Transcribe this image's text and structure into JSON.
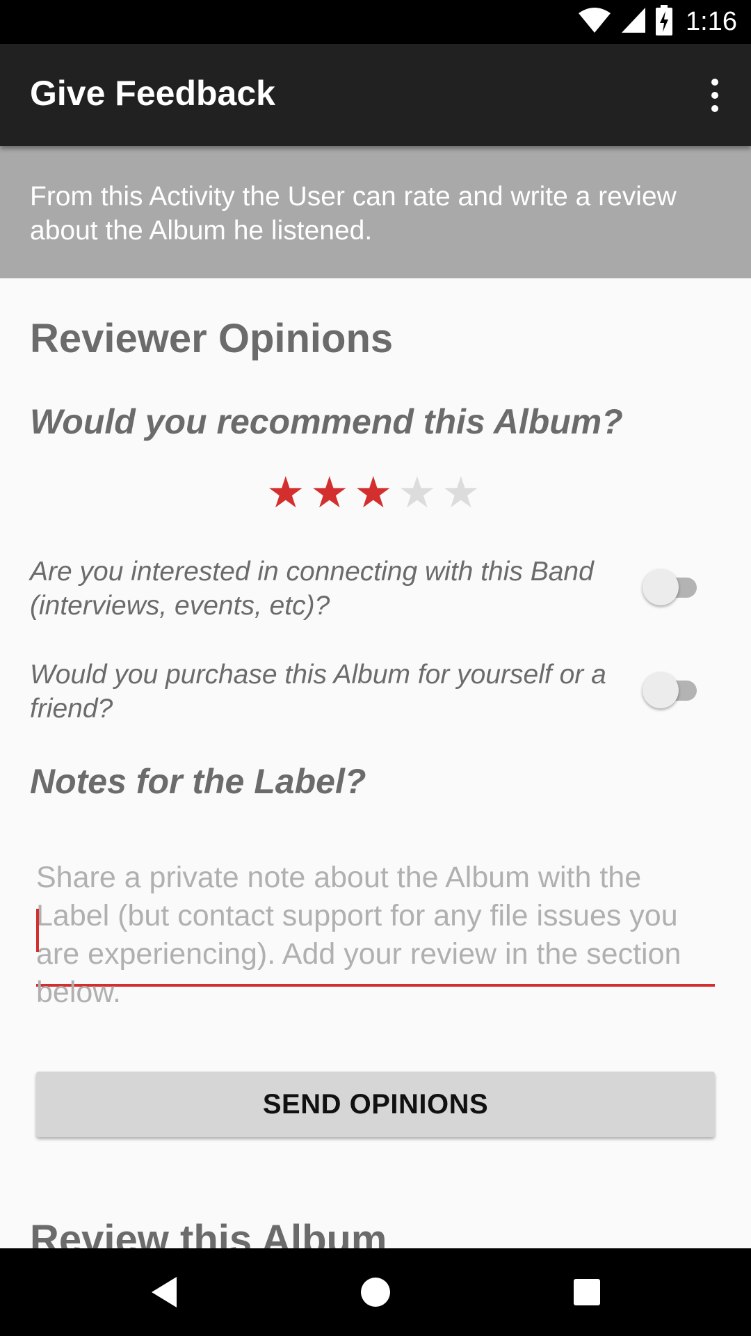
{
  "status_bar": {
    "time": "1:16",
    "icons": [
      "wifi-icon",
      "cellular-signal-icon",
      "battery-charging-icon"
    ]
  },
  "app_bar": {
    "title": "Give Feedback",
    "overflow_icon": "more-vert-icon"
  },
  "banner": {
    "text": "From this Activity the User can rate and write a review about the Album he listened."
  },
  "reviewer_opinions": {
    "section_title": "Reviewer Opinions",
    "recommend_question": "Would you recommend this Album?",
    "rating": {
      "value": 3,
      "max": 5,
      "filled_color": "#d32f2f",
      "empty_color": "#dcdcdc"
    },
    "connect_question": "Are you interested in connecting with this Band (interviews, events, etc)?",
    "connect_switch_on": false,
    "purchase_question": "Would you purchase this Album for yourself or a friend?",
    "purchase_switch_on": false,
    "notes_title": "Notes for the Label?",
    "notes_placeholder": "Share a private note about the Album with the Label (but contact support for any file issues you are experiencing). Add your review in the section below.",
    "send_button_label": "SEND OPINIONS"
  },
  "review_section": {
    "title": "Review this Album"
  },
  "colors": {
    "accent": "#d32f2f",
    "app_bar": "#212121",
    "banner": "#a9a9a9"
  }
}
